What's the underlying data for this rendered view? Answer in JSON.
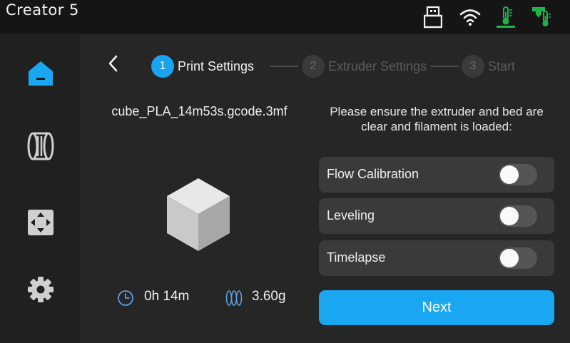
{
  "header": {
    "title": "Creator 5",
    "status_icons": [
      "usb-drive-icon",
      "wifi-icon",
      "bed-temperature-icon",
      "nozzle-temperature-icon"
    ]
  },
  "sidebar": {
    "items": [
      {
        "name": "home",
        "icon": "home-icon",
        "active": true
      },
      {
        "name": "filament",
        "icon": "filament-spool-icon",
        "active": false
      },
      {
        "name": "move",
        "icon": "move-controls-icon",
        "active": false
      },
      {
        "name": "settings",
        "icon": "gear-icon",
        "active": false
      }
    ]
  },
  "wizard": {
    "steps": [
      {
        "number": "1",
        "label": "Print Settings",
        "active": true
      },
      {
        "number": "2",
        "label": "Extruder Settings",
        "active": false
      },
      {
        "number": "3",
        "label": "Start",
        "active": false
      }
    ]
  },
  "file": {
    "name": "cube_PLA_14m53s.gcode.3mf",
    "time": "0h 14m",
    "weight": "3.60g"
  },
  "instructions": {
    "line1": "Please ensure the extruder and bed are",
    "line2": "clear and filament is loaded:"
  },
  "options": [
    {
      "label": "Flow Calibration",
      "enabled": false
    },
    {
      "label": "Leveling",
      "enabled": false
    },
    {
      "label": "Timelapse",
      "enabled": false
    }
  ],
  "actions": {
    "next_label": "Next"
  },
  "colors": {
    "accent": "#1aa7f2",
    "temp_green": "#22b24c"
  }
}
